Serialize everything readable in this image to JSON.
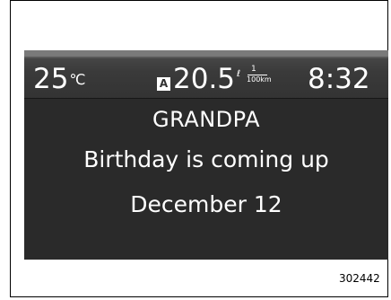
{
  "status_bar": {
    "temperature_value": "25",
    "temperature_unit": "℃",
    "fuel_mode_badge": "A",
    "fuel_economy_value": "20.5",
    "fuel_unit_liters": "ℓ",
    "fuel_unit_numerator": "1",
    "fuel_unit_denominator": "100km",
    "clock": "8:32"
  },
  "message": {
    "title": "GRANDPA",
    "line1": "Birthday is coming up",
    "line2": "December 12"
  },
  "figure_code": "302442",
  "colors": {
    "screen_background": "#2a2a2a",
    "status_bar_top": "#7a7a7a",
    "text": "#ffffff",
    "page_background": "#ffffff"
  }
}
